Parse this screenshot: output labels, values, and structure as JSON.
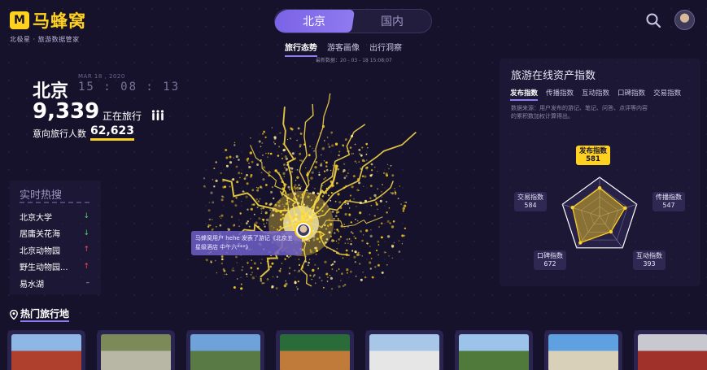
{
  "logo": {
    "mark": "M",
    "name": "马蜂窝",
    "subtitle": "北极星 · 旅游数据管家"
  },
  "region_tabs": [
    {
      "label": "北京",
      "active": true
    },
    {
      "label": "国内",
      "active": false
    }
  ],
  "sub_tabs": [
    {
      "label": "旅行态势",
      "active": true
    },
    {
      "label": "游客画像",
      "active": false
    },
    {
      "label": "出行洞察",
      "active": false
    }
  ],
  "update_time": "最新数据：20 - 03 - 18  15:08:07",
  "city": {
    "name": "北京",
    "date": "MAR 18 , 2020",
    "clock": "15 : 08 : 13",
    "traveling_count": "9,339",
    "traveling_label": "正在旅行",
    "intent_label": "意向旅行人数",
    "intent_count": "62,623"
  },
  "hot_search": {
    "title": "实时热搜",
    "items": [
      {
        "name": "北京大学",
        "trend": "down",
        "symbol": "↓"
      },
      {
        "name": "居庸关花海",
        "trend": "down",
        "symbol": "↓"
      },
      {
        "name": "北京动物园",
        "trend": "up",
        "symbol": "↑"
      },
      {
        "name": "野生动物园...",
        "trend": "up",
        "symbol": "↑"
      },
      {
        "name": "易水湖",
        "trend": "flat",
        "symbol": "–"
      }
    ]
  },
  "destinations": {
    "title": "热门旅行地",
    "photos": [
      {
        "name": "photo-forbidden-city",
        "colors": [
          "#8fb7e6",
          "#b0402e"
        ]
      },
      {
        "name": "photo-great-wall",
        "colors": [
          "#7c8a5a",
          "#b8b7a6"
        ]
      },
      {
        "name": "photo-temple-heaven",
        "colors": [
          "#6ea2d8",
          "#5a7a45"
        ]
      },
      {
        "name": "photo-gate-sign",
        "colors": [
          "#2a6b3a",
          "#c07a3a"
        ]
      },
      {
        "name": "photo-bridge",
        "colors": [
          "#a8c6e8",
          "#e6e6e6"
        ]
      },
      {
        "name": "photo-park",
        "colors": [
          "#9cc4ea",
          "#4f7a3c"
        ]
      },
      {
        "name": "photo-university",
        "colors": [
          "#5fa0e0",
          "#d8d0b8"
        ]
      },
      {
        "name": "photo-red-building",
        "colors": [
          "#c8c8d0",
          "#a0302a"
        ]
      }
    ]
  },
  "map": {
    "tooltip": "马蜂窝用户 hehe 发表了游记《北京五星级酒店 中午六***》"
  },
  "asset_index": {
    "title": "旅游在线资产指数",
    "tabs": [
      {
        "label": "发布指数",
        "active": true
      },
      {
        "label": "传播指数",
        "active": false
      },
      {
        "label": "互动指数",
        "active": false
      },
      {
        "label": "口碑指数",
        "active": false
      },
      {
        "label": "交易指数",
        "active": false
      }
    ],
    "description": "数据来源：用户发布的游记、笔记、问答、点评等内容的累积数加权计算得出。",
    "radar": [
      {
        "name": "发布指数",
        "value": 581
      },
      {
        "name": "传播指数",
        "value": 547
      },
      {
        "name": "互动指数",
        "value": 393
      },
      {
        "name": "口碑指数",
        "value": 672
      },
      {
        "name": "交易指数",
        "value": 584
      }
    ]
  },
  "colors": {
    "background": "#16122b",
    "accent_purple": "#8f7af0",
    "accent_yellow": "#ffd21f",
    "trend_up": "#ff4a5a",
    "trend_down": "#52d273"
  }
}
